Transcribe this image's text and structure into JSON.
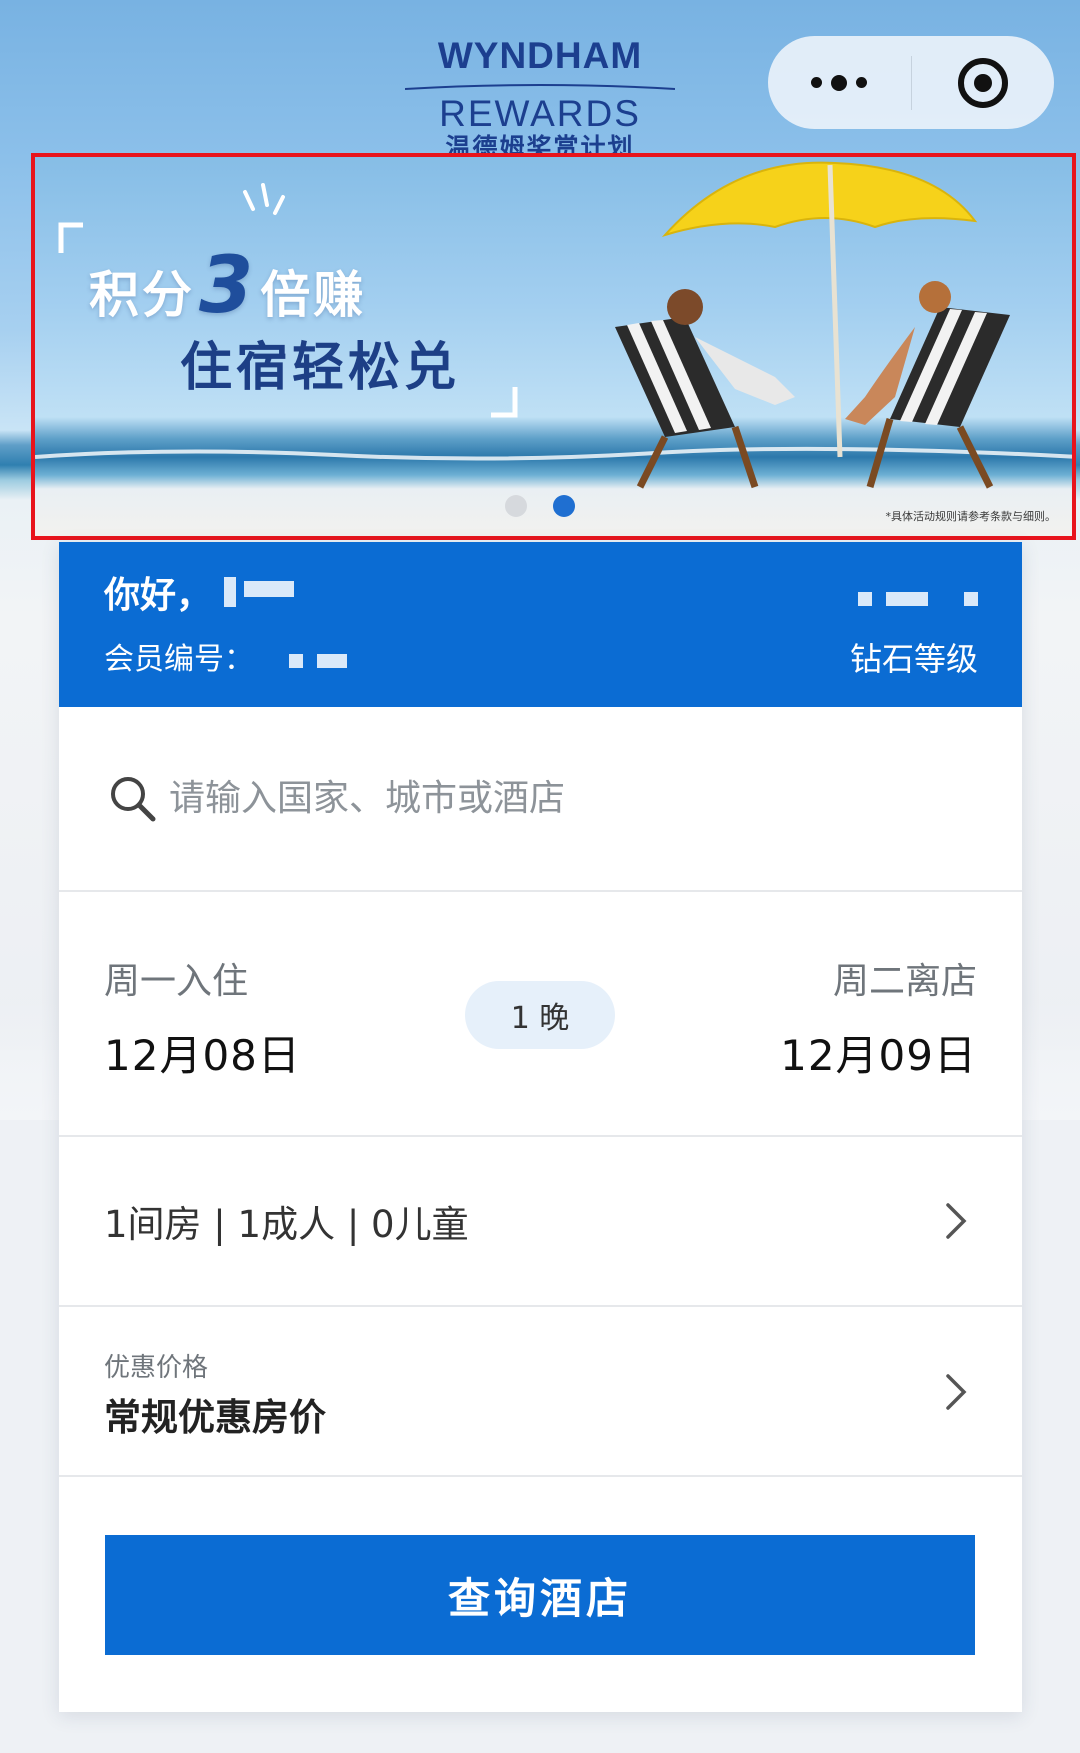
{
  "logo": {
    "line1": "WYNDHAM",
    "line2": "REWARDS",
    "cn": "温德姆奖赏计划"
  },
  "capsule": {
    "more_icon": "more-dots-icon",
    "close_icon": "target-close-icon"
  },
  "banner": {
    "headline_part1": "积分",
    "headline_number": "3",
    "headline_part2": "倍赚",
    "subline": "住宿轻松兑",
    "fine_print": "*具体活动规则请参考条款与细则。",
    "slides": 2,
    "active_slide": 2
  },
  "member": {
    "greeting": "你好，",
    "member_no_label": "会员编号：",
    "tier": "钻石等级"
  },
  "search": {
    "placeholder": "请输入国家、城市或酒店"
  },
  "dates": {
    "checkin_label": "周一入住",
    "checkin_date": "12月08日",
    "nights": "1 晚",
    "checkout_label": "周二离店",
    "checkout_date": "12月09日"
  },
  "guests": {
    "summary": "1间房 | 1成人 | 0儿童"
  },
  "rate": {
    "label": "优惠价格",
    "value": "常规优惠房价"
  },
  "actions": {
    "search_button": "查询酒店"
  },
  "colors": {
    "primary": "#0b6cd3",
    "banner_border": "#e8141c",
    "pill_bg": "#e6f0fa"
  }
}
